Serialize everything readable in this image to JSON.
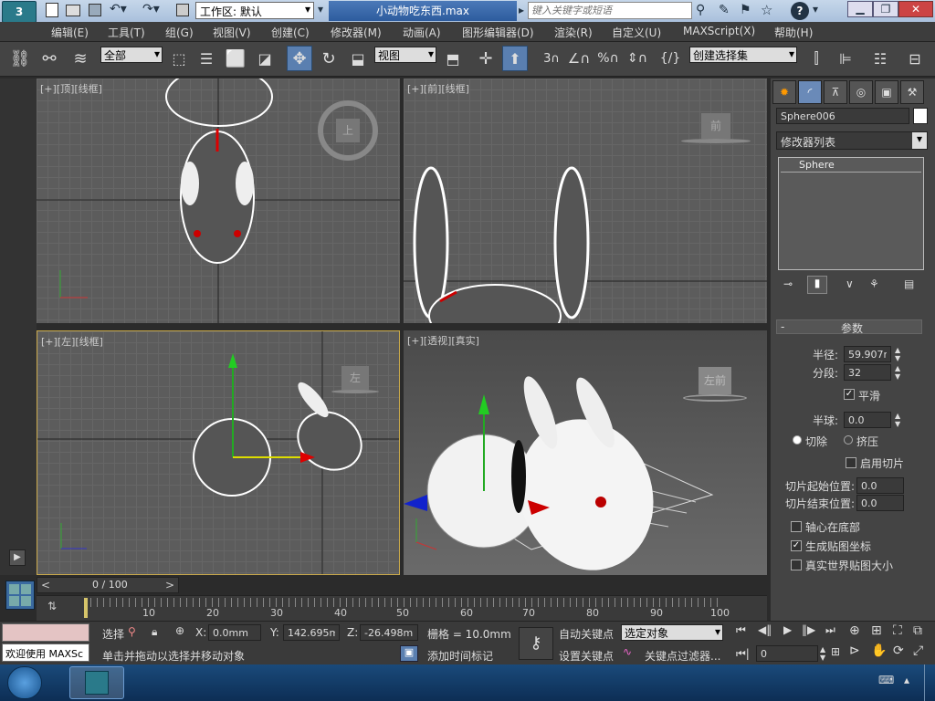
{
  "titlebar": {
    "workspace_label": "工作区: 默认",
    "file_title": "小动物吃东西.max",
    "search_placeholder": "键入关键字或短语"
  },
  "menu": [
    "编辑(E)",
    "工具(T)",
    "组(G)",
    "视图(V)",
    "创建(C)",
    "修改器(M)",
    "动画(A)",
    "图形编辑器(D)",
    "渲染(R)",
    "自定义(U)",
    "MAXScript(X)",
    "帮助(H)"
  ],
  "toolbar": {
    "selection_filter": "全部",
    "ref_coord": "视图",
    "named_selection": "创建选择集"
  },
  "viewports": {
    "top": {
      "label": "[+][顶][线框]",
      "cube": "上"
    },
    "front": {
      "label": "[+][前][线框]",
      "cube": "前"
    },
    "left": {
      "label": "[+][左][线框]",
      "cube": "左"
    },
    "persp": {
      "label": "[+][透视][真实]",
      "cube": "左前"
    }
  },
  "command_panel": {
    "object_name": "Sphere006",
    "modifier_list": "修改器列表",
    "stack_item": "Sphere",
    "rollout_title": "参数",
    "radius_label": "半径:",
    "radius_value": "59.907mm",
    "segments_label": "分段:",
    "segments_value": "32",
    "smooth_label": "平滑",
    "hemisphere_label": "半球:",
    "hemisphere_value": "0.0",
    "chop_label": "切除",
    "squash_label": "挤压",
    "slice_on_label": "启用切片",
    "slice_from_label": "切片起始位置:",
    "slice_from_value": "0.0",
    "slice_to_label": "切片结束位置:",
    "slice_to_value": "0.0",
    "base_pivot_label": "轴心在底部",
    "gen_map_label": "生成贴图坐标",
    "real_world_label": "真实世界贴图大小"
  },
  "timeline": {
    "slider_label": "0 / 100",
    "ticks": [
      "10",
      "20",
      "30",
      "40",
      "50",
      "60",
      "70",
      "80",
      "90",
      "100"
    ]
  },
  "status": {
    "welcome": "欢迎使用 MAXSc",
    "select_label": "选择",
    "x_label": "X:",
    "x_value": "0.0mm",
    "y_label": "Y:",
    "y_value": "142.695mm",
    "z_label": "Z:",
    "z_value": "-26.498mm",
    "grid_label": "栅格 = 10.0mm",
    "prompt": "单击并拖动以选择并移动对象",
    "add_time_tag": "添加时间标记",
    "auto_key": "自动关键点",
    "set_key": "设置关键点",
    "selected_object": "选定对象",
    "key_filters": "关键点过滤器...",
    "frame_value": "0"
  },
  "colors": {
    "accent": "#2b6cb0",
    "wire": "#ffffff"
  }
}
